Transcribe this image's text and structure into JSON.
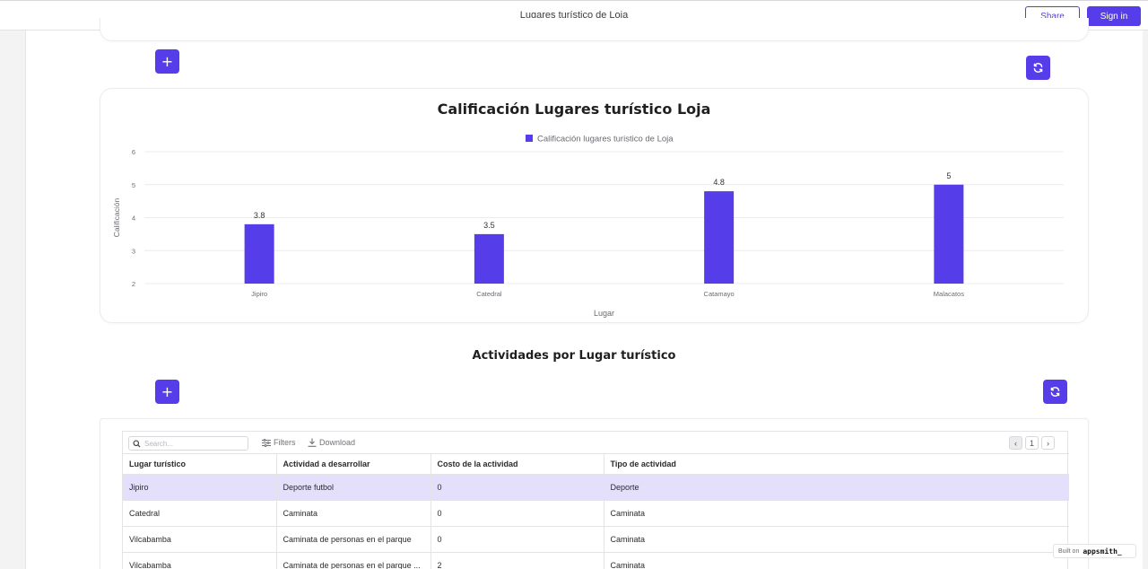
{
  "header": {
    "title": "Lugares turístico de Loja",
    "share_label": "Share",
    "signin_label": "Sign in"
  },
  "icons": {
    "add": "plus-icon",
    "refresh": "refresh-icon"
  },
  "colors": {
    "accent": "#553de9",
    "selected_row": "#e4e0fb"
  },
  "chart_section": {
    "add_symbol": "+"
  },
  "chart_data": {
    "type": "bar",
    "title": "Calificación Lugares turístico Loja",
    "xlabel": "Lugar",
    "ylabel": "Calificación",
    "categories": [
      "Jipiro",
      "Catedral",
      "Catamayo",
      "Malacatos"
    ],
    "series": [
      {
        "name": "Calificación lugares turistico de Loja",
        "values": [
          3.8,
          3.5,
          4.8,
          5
        ],
        "color": "#553de9"
      }
    ],
    "ylim": [
      2,
      6
    ],
    "yticks": [
      "2",
      "3",
      "4",
      "5",
      "6"
    ],
    "data_labels": [
      "3.8",
      "3.5",
      "4.8",
      "5"
    ],
    "grid": true,
    "legend_position": "top"
  },
  "table_section": {
    "title": "Actividades por Lugar turístico",
    "add_symbol": "+",
    "search_placeholder": "Search...",
    "filters_label": "Filters",
    "download_label": "Download",
    "page_number": "1",
    "columns": [
      "Lugar turístico",
      "Actividad a desarrollar",
      "Costo de la actividad",
      "Tipo de actividad"
    ],
    "rows": [
      [
        "Jipiro",
        "Deporte futbol",
        "0",
        "Deporte"
      ],
      [
        "Catedral",
        "Caminata",
        "0",
        "Caminata"
      ],
      [
        "Vilcabamba",
        "Caminata de personas en el parque",
        "0",
        "Caminata"
      ],
      [
        "Vilcabamba",
        "Caminata de personas en el parque ...",
        "2",
        "Caminata"
      ]
    ]
  },
  "footer": {
    "built_on": "Built on",
    "brand": "appsmith_"
  }
}
